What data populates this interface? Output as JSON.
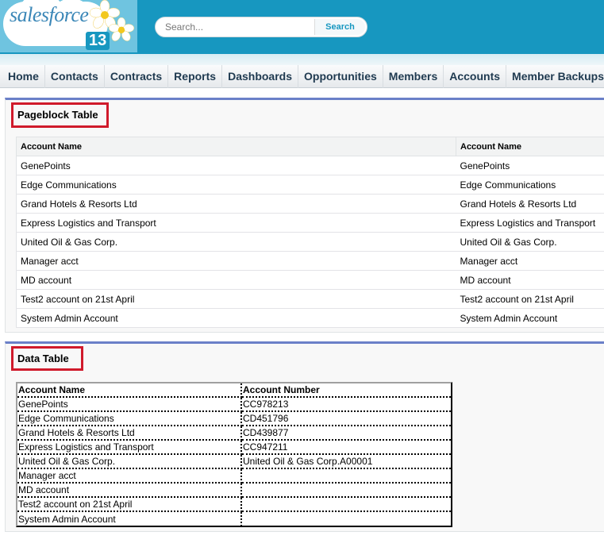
{
  "header": {
    "logo_text": "salesforce",
    "logo_version": "13",
    "search_placeholder": "Search...",
    "search_button": "Search",
    "colors": {
      "header_bg": "#1797c0",
      "accent": "#6a80c8",
      "highlight": "#d01a2b"
    }
  },
  "nav": {
    "items": [
      "Home",
      "Contacts",
      "Contracts",
      "Reports",
      "Dashboards",
      "Opportunities",
      "Members",
      "Accounts",
      "Member Backups"
    ]
  },
  "pageblock": {
    "title": "Pageblock Table",
    "headers": [
      "Account Name",
      "Account Name"
    ],
    "rows": [
      [
        "GenePoints",
        "GenePoints"
      ],
      [
        "Edge Communications",
        "Edge Communications"
      ],
      [
        "Grand Hotels & Resorts Ltd",
        "Grand Hotels & Resorts Ltd"
      ],
      [
        "Express Logistics and Transport",
        "Express Logistics and Transport"
      ],
      [
        "United Oil & Gas Corp.",
        "United Oil & Gas Corp."
      ],
      [
        "Manager acct",
        "Manager acct"
      ],
      [
        "MD account",
        "MD account"
      ],
      [
        "Test2 account on 21st April",
        "Test2 account on 21st April"
      ],
      [
        "System Admin Account",
        "System Admin Account"
      ]
    ]
  },
  "datatable": {
    "title": "Data Table",
    "headers": [
      "Account Name",
      "Account Number"
    ],
    "rows": [
      [
        "GenePoints",
        "CC978213"
      ],
      [
        "Edge Communications",
        "CD451796"
      ],
      [
        "Grand Hotels & Resorts Ltd",
        "CD439877"
      ],
      [
        "Express Logistics and Transport",
        "CC947211"
      ],
      [
        "United Oil & Gas Corp.",
        "United Oil & Gas Corp.A00001"
      ],
      [
        "Manager acct",
        ""
      ],
      [
        "MD account",
        ""
      ],
      [
        "Test2 account on 21st April",
        ""
      ],
      [
        "System Admin Account",
        ""
      ]
    ]
  }
}
